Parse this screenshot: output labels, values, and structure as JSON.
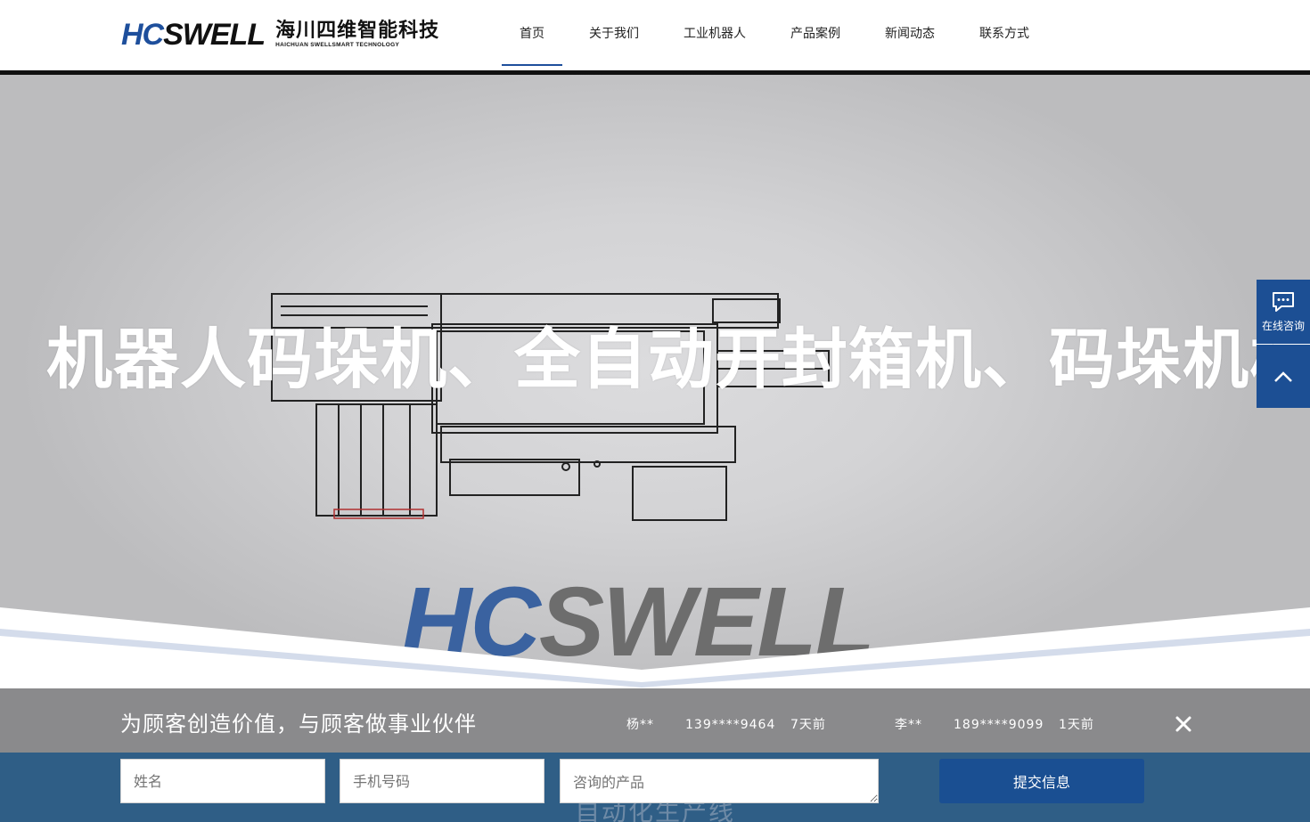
{
  "logo": {
    "mark_a": "HC",
    "mark_b": "SWELL",
    "cn": "海川四维智能科技",
    "en": "HAICHUAN SWELLSMART TECHNOLOGY"
  },
  "nav": {
    "items": [
      {
        "label": "首页",
        "active": true
      },
      {
        "label": "关于我们"
      },
      {
        "label": "工业机器人"
      },
      {
        "label": "产品案例"
      },
      {
        "label": "新闻动态"
      },
      {
        "label": "联系方式"
      }
    ]
  },
  "hero": {
    "title": "机器人码垛机、全自动开封箱机、码垛机械手",
    "brand_a": "HC",
    "brand_b": "SWELL"
  },
  "float": {
    "consult_label": "在线咨询",
    "consult_icon": "chat-bubble-icon",
    "top_icon": "chevron-up-icon"
  },
  "bar": {
    "slogan": "为顾客创造价值，与顾客做事业伙伴",
    "records": [
      {
        "name": "杨**",
        "phone": "139****9464",
        "time": "7天前"
      },
      {
        "name": "李**",
        "phone": "189****9099",
        "time": "1天前"
      }
    ],
    "close_icon": "close-icon"
  },
  "form": {
    "name_placeholder": "姓名",
    "phone_placeholder": "手机号码",
    "product_placeholder": "咨询的产品",
    "submit_label": "提交信息",
    "underlay_text": "自动化生产线"
  },
  "colors": {
    "brand_blue": "#1e4f9c",
    "float_blue": "#1c4f94",
    "bar_gray": "#8a8a8c",
    "bar_blue": "#2f5e86"
  }
}
